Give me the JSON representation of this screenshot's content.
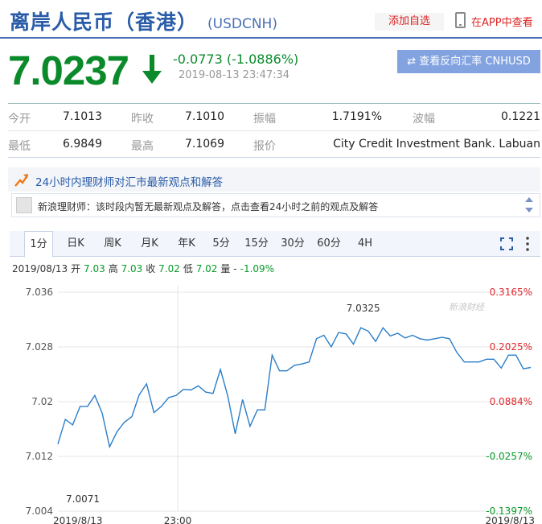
{
  "header": {
    "title": "离岸人民币（香港）",
    "code": "(USDCNH)",
    "add_fav": "添加自选",
    "app_link": "在APP中查看"
  },
  "quote": {
    "price": "7.0237",
    "change": "-0.0773 (-1.0886%)",
    "time": "2019-08-13 23:47:34",
    "reverse_btn": "⇄ 查看反向汇率 CNHUSD",
    "arrow_icon": "down-arrow-icon",
    "down_color": "#0a8a2a"
  },
  "stats": {
    "row1": [
      {
        "label": "今开",
        "value": "7.1013"
      },
      {
        "label": "昨收",
        "value": "7.1010"
      },
      {
        "label": "振幅",
        "value": "1.7191%"
      },
      {
        "label": "波幅",
        "value": "0.1221"
      }
    ],
    "row2": [
      {
        "label": "最低",
        "value": "6.9849"
      },
      {
        "label": "最高",
        "value": "7.1069"
      },
      {
        "label": "报价",
        "value": "City Credit Investment Bank. Labuan"
      }
    ]
  },
  "advice": {
    "title": "24小时内理财师对汇市最新观点和解答",
    "text": "新浪理财师：该时段内暂无最新观点及解答，点击查看24小时之前的观点及解答"
  },
  "tabs": [
    "1分",
    "日K",
    "周K",
    "月K",
    "年K",
    "5分",
    "15分",
    "30分",
    "60分",
    "4H"
  ],
  "active_tab": "1分",
  "ohlc": {
    "date": "2019/08/13",
    "open_label": "开",
    "open": "7.03",
    "high_label": "高",
    "high": "7.03",
    "close_label": "收",
    "close": "7.02",
    "low_label": "低",
    "low": "7.02",
    "vol_label": "量",
    "vol": "-",
    "pct": "-1.09%"
  },
  "chart_data": {
    "type": "line",
    "watermark": "新浪财经",
    "y_ticks": [
      "7.036",
      "7.028",
      "7.02",
      "7.012",
      "7.004"
    ],
    "y_tick_values": [
      7.036,
      7.028,
      7.02,
      7.012,
      7.004
    ],
    "pct_ticks": [
      "0.3165%",
      "0.2025%",
      "0.0884%",
      "-0.0257%",
      "-0.1397%"
    ],
    "pct_colors": [
      "#e0262b",
      "#e0262b",
      "#e0262b",
      "#0a9a2a",
      "#0a9a2a"
    ],
    "ylim": [
      7.004,
      7.036
    ],
    "x_labels": [
      "2019/8/13",
      "23:00",
      "2019/8/13"
    ],
    "max_label": "7.0325",
    "min_label": "7.0071",
    "line_color": "#2b7ec8",
    "values": [
      7.0138,
      7.0174,
      7.0166,
      7.0193,
      7.0193,
      7.0209,
      7.0183,
      7.0134,
      7.0156,
      7.017,
      7.0178,
      7.021,
      7.0226,
      7.0184,
      7.0193,
      7.0206,
      7.0209,
      7.0218,
      7.0217,
      7.0223,
      7.0214,
      7.0212,
      7.0247,
      7.0208,
      7.0153,
      7.0203,
      7.0164,
      7.0188,
      7.0188,
      7.0268,
      7.0245,
      7.0245,
      7.0253,
      7.0255,
      7.0258,
      7.0292,
      7.0297,
      7.028,
      7.0301,
      7.0299,
      7.0284,
      7.0308,
      7.0303,
      7.0288,
      7.0308,
      7.0296,
      7.03,
      7.0293,
      7.0297,
      7.0292,
      7.029,
      7.0292,
      7.0294,
      7.0292,
      7.0272,
      7.0258,
      7.0258,
      7.0258,
      7.0262,
      7.0262,
      7.0249,
      7.0268,
      7.0268,
      7.0248,
      7.025
    ]
  }
}
